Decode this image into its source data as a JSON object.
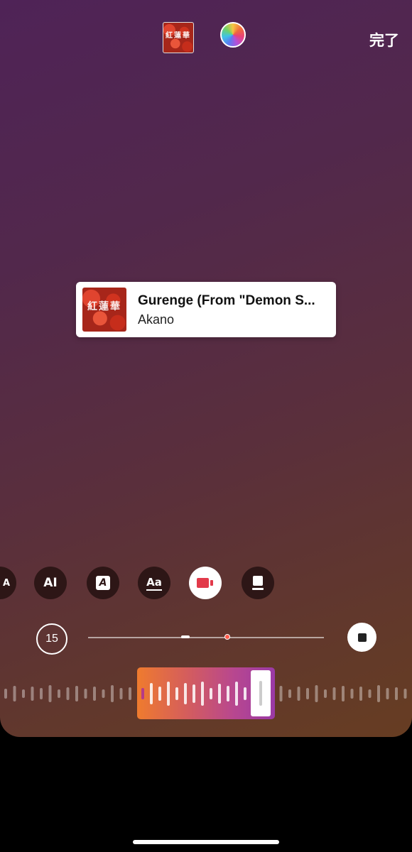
{
  "header": {
    "artwork_text": "紅蓮華",
    "color_picker_icon": "color-wheel-icon",
    "done_label": "完了"
  },
  "sticker": {
    "artwork_text": "紅蓮華",
    "title": "Gurenge (From \"Demon S...",
    "artist": "Akano"
  },
  "style_options": [
    {
      "name": "style-text-a",
      "glyph": "A"
    },
    {
      "name": "style-text-ai",
      "glyph": "AI"
    },
    {
      "name": "style-text-boxed-a",
      "glyph": "A"
    },
    {
      "name": "style-text-aa",
      "glyph": "Aa"
    },
    {
      "name": "style-album-card",
      "glyph": "",
      "selected": true
    },
    {
      "name": "style-album-square",
      "glyph": ""
    }
  ],
  "controls": {
    "duration": "15",
    "playback_icon": "stop-icon"
  },
  "colors": {
    "selection_start": "#ef7b2e",
    "selection_end": "#9a3aa6",
    "scrub_marker": "#ff5a4a"
  }
}
